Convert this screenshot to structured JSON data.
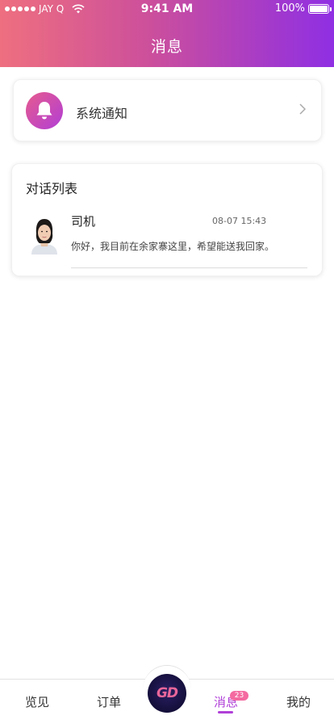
{
  "status_bar": {
    "carrier": "JAY Q",
    "time": "9:41 AM",
    "battery": "100%"
  },
  "header": {
    "title": "消息"
  },
  "notice": {
    "label": "系统通知",
    "icon": "bell-icon"
  },
  "conversations": {
    "title": "对话列表",
    "items": [
      {
        "name": "司机",
        "time": "08-07 15:43",
        "message": "你好，我目前在余家寨这里，希望能送我回家。"
      }
    ]
  },
  "tabbar": {
    "tabs": [
      {
        "label": "览见"
      },
      {
        "label": "订单"
      },
      {
        "label": "消息"
      },
      {
        "label": "我的"
      }
    ],
    "badge": "23",
    "center_logo": "GD",
    "active_color": "#b040d8"
  },
  "colors": {
    "header_start": "#ee6f7f",
    "header_end": "#8f2fe3",
    "badge": "#f46aa0"
  }
}
